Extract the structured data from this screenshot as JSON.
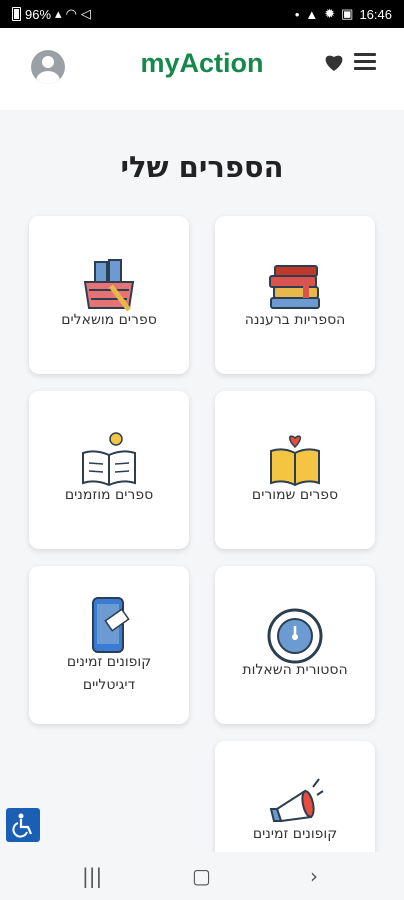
{
  "status_bar": {
    "battery": "96%",
    "time": "16:46",
    "icons": [
      "battery-icon",
      "signal-icon",
      "wifi-icon",
      "mute-icon",
      "dot-icon",
      "alert-icon",
      "settings-icon",
      "image-icon"
    ]
  },
  "header": {
    "logo": "myAction",
    "icons": [
      "avatar-icon",
      "heart-icon",
      "menu-icon"
    ]
  },
  "page_title": "הספרים שלי",
  "cards": [
    {
      "label": "הספריות ברעננה",
      "icon": "books-stack-icon"
    },
    {
      "label": "ספרים מושאלים",
      "icon": "books-basket-icon"
    },
    {
      "label": "ספרים שמורים",
      "icon": "book-heart-icon"
    },
    {
      "label": "ספרים מוזמנים",
      "icon": "open-book-idea-icon"
    },
    {
      "label": "הסטורית השאלות",
      "icon": "history-icon"
    },
    {
      "label_line1": "קופונים זמינים",
      "label_line2": "דיגיטליים",
      "icon": "phone-ticket-icon"
    },
    {
      "label": "קופונים זמינים",
      "icon": "megaphone-icon"
    }
  ],
  "colors": {
    "brand": "#15884b",
    "accessibility": "#1a5fb4"
  }
}
